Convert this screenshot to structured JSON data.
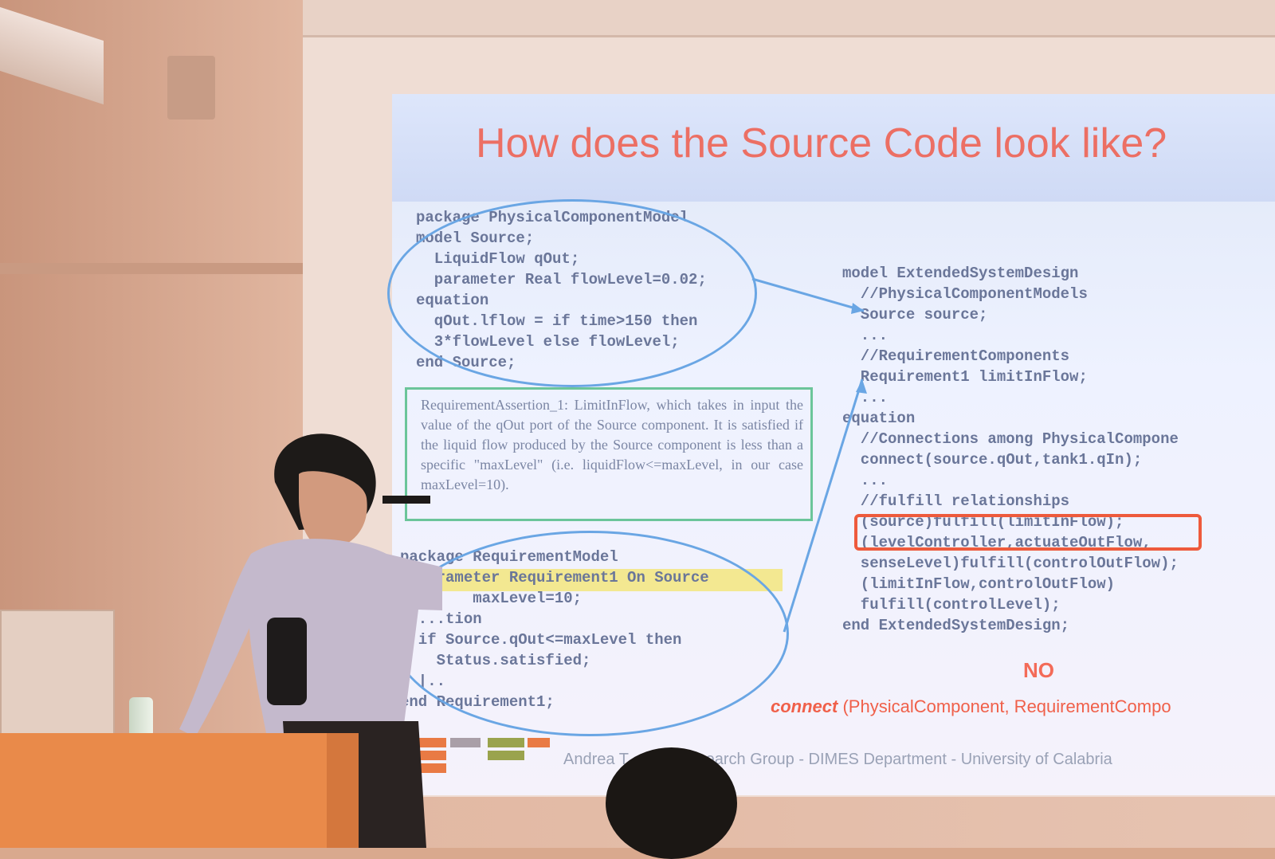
{
  "slide": {
    "title": "How does the Source Code look like?",
    "code_left": [
      "package PhysicalComponentModel",
      "model Source;",
      "  LiquidFlow qOut;",
      "  parameter Real flowLevel=0.02;",
      "equation",
      "  qOut.lflow = if time>150 then",
      "  3*flowLevel else flowLevel;",
      "end Source;"
    ],
    "requirement_text": "RequirementAssertion_1: LimitInFlow, which takes in input the value of the qOut port of the Source component. It is satisfied if the liquid flow produced by the Source component is less than a specific \"maxLevel\" (i.e. liquidFlow<=maxLevel, in our case maxLevel=10).",
    "code_mid": [
      "package RequirementModel",
      "  Parameter Requirement1 On Source",
      "  ...   maxLevel=10;",
      "  ...tion",
      "  if Source.qOut<=maxLevel then",
      "    Status.satisfied;",
      "  |..",
      "end Requirement1;"
    ],
    "code_right": [
      "model ExtendedSystemDesign",
      "  //PhysicalComponentModels",
      "  Source source;",
      "  ...",
      "  //RequirementComponents",
      "  Requirement1 limitInFlow;",
      "  ...",
      "equation",
      "  //Connections among PhysicalCompone",
      "  connect(source.qOut,tank1.qIn);",
      "  ...",
      "  //fulfill relationships",
      "  (source)fulfill(limitInFlow);",
      "  (levelController,actuateOutFlow,",
      "  senseLevel)fulfill(controlOutFlow);",
      "  (limitInFlow,controlOutFlow)",
      "  fulfill(controlLevel);",
      "end ExtendedSystemDesign;"
    ],
    "no_label": "NO",
    "connect_keyword": "connect",
    "connect_args": " (PhysicalComponent,  RequirementCompo",
    "footer": "Andrea T... ...EI Research Group - DIMES Department - University of Calabria"
  },
  "colors": {
    "title": "#ec6f64",
    "code": "#6a7699",
    "ellipse": "#6aa6e4",
    "red_box": "#ee5a3c",
    "req_box": "#6bc59a"
  }
}
